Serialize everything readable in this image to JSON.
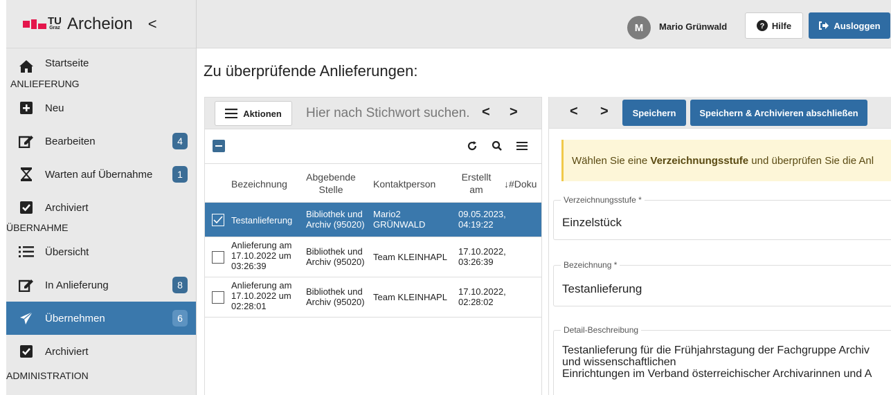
{
  "brand": {
    "logo_text": "TU",
    "logo_sub": "Graz",
    "app_name": "Archeion",
    "collapse_glyph": "<"
  },
  "header": {
    "avatar_initial": "M",
    "user_name": "Mario Grünwald",
    "help_label": "Hilfe",
    "logout_label": "Ausloggen"
  },
  "sidebar": {
    "home": {
      "label": "Startseite",
      "icon": "home-icon"
    },
    "sections": {
      "delivery": "ANLIEFERUNG",
      "takeover": "ÜBERNAHME",
      "admin": "ADMINISTRATION"
    },
    "delivery_items": [
      {
        "label": "Neu",
        "icon": "plus-square-icon",
        "badge": ""
      },
      {
        "label": "Bearbeiten",
        "icon": "edit-icon",
        "badge": "4"
      },
      {
        "label": "Warten auf Übernahme",
        "icon": "hourglass-icon",
        "badge": "1"
      },
      {
        "label": "Archiviert",
        "icon": "check-square-icon",
        "badge": ""
      }
    ],
    "takeover_items": [
      {
        "label": "Übersicht",
        "icon": "list-icon",
        "badge": ""
      },
      {
        "label": "In Anlieferung",
        "icon": "edit-icon",
        "badge": "8"
      },
      {
        "label": "Übernehmen",
        "icon": "paper-plane-icon",
        "badge": "6",
        "active": true
      },
      {
        "label": "Archiviert",
        "icon": "check-square-icon",
        "badge": ""
      }
    ]
  },
  "page": {
    "title": "Zu überprüfende Anlieferungen:"
  },
  "list": {
    "actions_label": "Aktionen",
    "search_placeholder": "Hier nach Stichwort suchen.",
    "prev_glyph": "<",
    "next_glyph": ">",
    "columns": [
      "Bezeichnung",
      "Abgebende Stelle",
      "Kontaktperson",
      "Erstellt am",
      "↓#Doku"
    ],
    "rows": [
      {
        "name": "Testanlieferung",
        "stelle": "Bibliothek und Archiv (95020)",
        "kontakt": "Mario2 GRÜNWALD",
        "erstellt": "09.05.2023, 04:19:22",
        "selected": true
      },
      {
        "name": "Anlieferung am 17.10.2022 um 03:26:39",
        "stelle": "Bibliothek und Archiv (95020)",
        "kontakt": "Team KLEINHAPL",
        "erstellt": "17.10.2022, 03:26:39",
        "selected": false
      },
      {
        "name": "Anlieferung am 17.10.2022 um 02:28:01",
        "stelle": "Bibliothek und Archiv (95020)",
        "kontakt": "Team KLEINHAPL",
        "erstellt": "17.10.2022, 02:28:02",
        "selected": false
      }
    ]
  },
  "detail": {
    "prev_glyph": "<",
    "next_glyph": ">",
    "save_label": "Speichern",
    "save_archive_label": "Speichern & Archivieren abschließen",
    "alert_pre": "Wählen Sie eine ",
    "alert_bold": "Verzeichnungsstufe",
    "alert_post": " und überprüfen Sie die Anl",
    "fields": {
      "level_label": "Verzeichnungsstufe *",
      "level_value": "Einzelstück",
      "name_label": "Bezeichnung *",
      "name_value": "Testanlieferung",
      "desc_label": "Detail-Beschreibung",
      "desc_line1": "Testanlieferung für die Frühjahrstagung der Fachgruppe Archiv",
      "desc_line2": "und wissenschaftlichen",
      "desc_line3": "Einrichtungen im Verband österreichischer Archivarinnen und A"
    }
  },
  "colors": {
    "accent": "#3a78ac",
    "button": "#2f6ca3",
    "badge": "#3b6d96",
    "brand_red": "#e4154b"
  }
}
